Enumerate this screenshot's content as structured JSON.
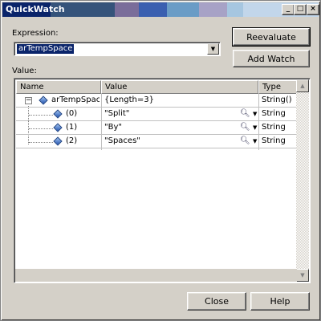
{
  "window": {
    "title": "QuickWatch",
    "min_symbol": "_",
    "max_symbol": "□",
    "close_symbol": "×"
  },
  "expression": {
    "label": "Expression:",
    "value": "arTempSpace"
  },
  "buttons": {
    "reevaluate": "Reevaluate",
    "add_watch": "Add Watch",
    "close": "Close",
    "help": "Help"
  },
  "value_section": {
    "label": "Value:",
    "columns": [
      "Name",
      "Value",
      "Type"
    ],
    "rows": [
      {
        "name": "arTempSpac",
        "value": "{Length=3}",
        "type": "String()",
        "expander": "−"
      },
      {
        "name": "(0)",
        "value": "\"Split\"",
        "type": "String"
      },
      {
        "name": "(1)",
        "value": "\"By\"",
        "type": "String"
      },
      {
        "name": "(2)",
        "value": "\"Spaces\"",
        "type": "String"
      }
    ]
  },
  "icons": {
    "variable": "blue-gem-icon",
    "magnifier": "magnifier-icon",
    "dropdown": "chevron-down-icon",
    "scroll_up": "▲",
    "scroll_down": "▼",
    "combo_arrow": "▼"
  },
  "colors": {
    "selection": "#0a246a",
    "face": "#d4d0c8"
  }
}
